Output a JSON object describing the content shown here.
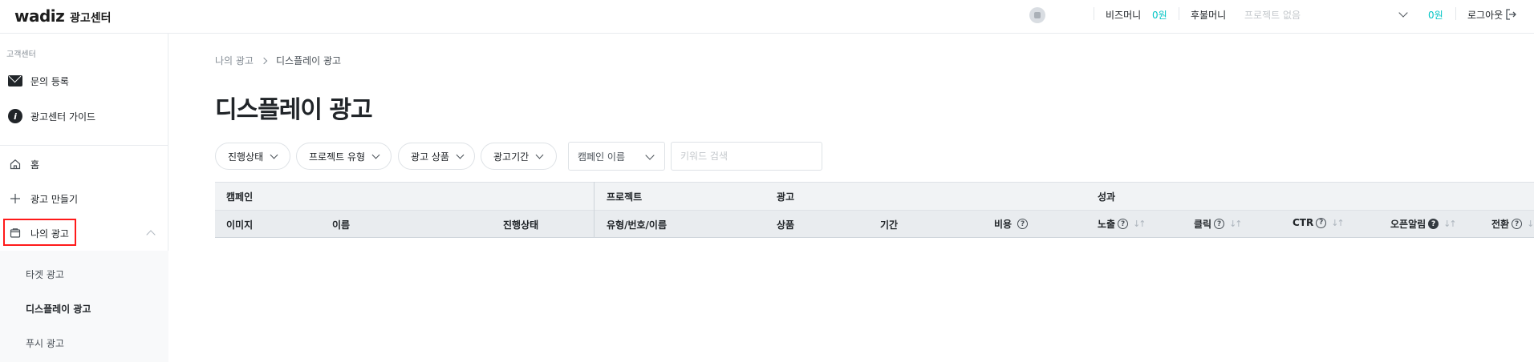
{
  "header": {
    "logo_text": "wadiz",
    "logo_sub": "광고센터",
    "biz_money_label": "비즈머니",
    "biz_money_value": "0원",
    "postpaid_label": "후불머니",
    "project_placeholder": "프로젝트 없음",
    "postpaid_value": "0원",
    "logout_label": "로그아웃"
  },
  "sidebar": {
    "section_label": "고객센터",
    "support_items": [
      {
        "label": "문의 등록",
        "icon": "mail-icon"
      },
      {
        "label": "광고센터 가이드",
        "icon": "info-icon"
      }
    ],
    "nav_items": [
      {
        "label": "홈",
        "icon": "home-icon"
      },
      {
        "label": "광고 만들기",
        "icon": "plus-icon"
      },
      {
        "label": "나의 광고",
        "icon": "folder-icon"
      }
    ],
    "sub_items": [
      {
        "label": "타겟 광고"
      },
      {
        "label": "디스플레이 광고"
      },
      {
        "label": "푸시 광고"
      }
    ]
  },
  "main": {
    "breadcrumb": [
      "나의 광고",
      "디스플레이 광고"
    ],
    "title": "디스플레이 광고",
    "filters": [
      "진행상태",
      "프로젝트 유형",
      "광고 상품",
      "광고기간"
    ],
    "campaign_select": "캠페인 이름",
    "search_placeholder": "키워드 검색"
  },
  "table": {
    "groups": [
      "캠페인",
      "프로젝트",
      "광고",
      "성과"
    ],
    "columns": [
      "이미지",
      "이름",
      "진행상태",
      "유형/번호/이름",
      "상품",
      "기간",
      "비용",
      "노출",
      "클릭",
      "CTR",
      "오픈알림",
      "전환"
    ]
  }
}
